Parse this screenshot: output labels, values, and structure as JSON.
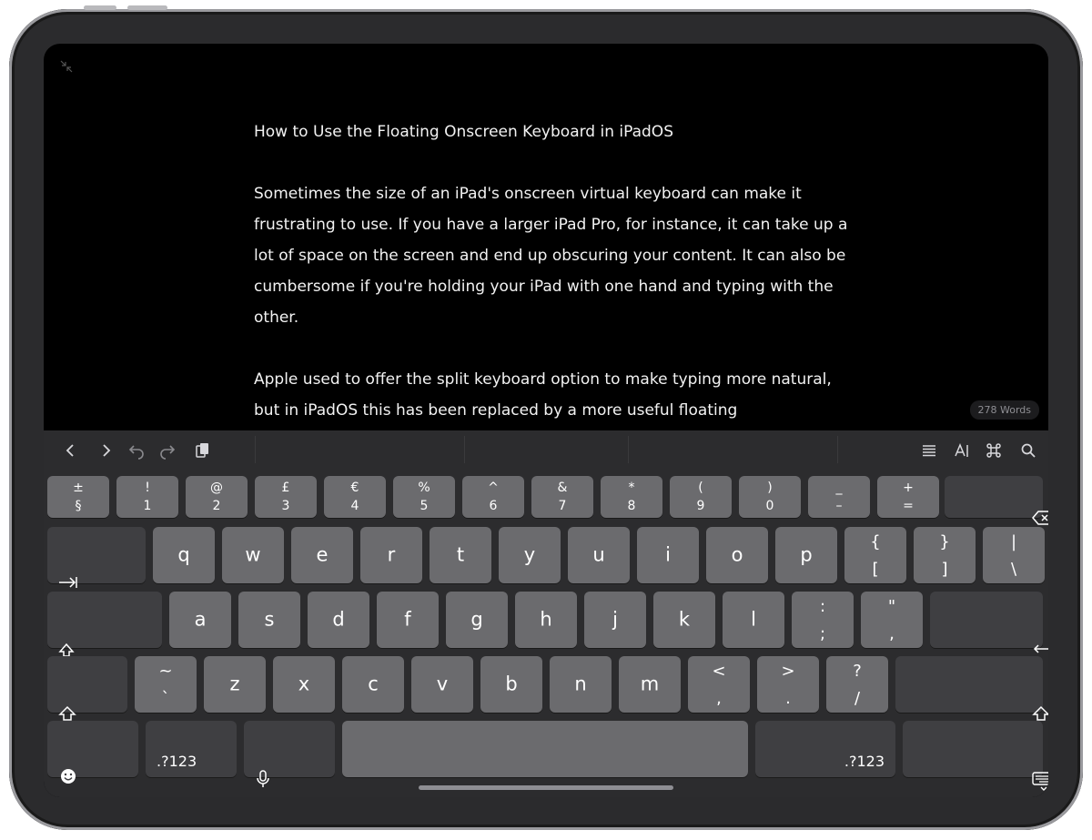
{
  "document": {
    "title": "How to Use the Floating Onscreen Keyboard in iPadOS",
    "paragraphs": [
      "Sometimes the size of an iPad's onscreen virtual keyboard can make it frustrating to use. If you have a larger iPad Pro, for instance, it can take up a lot of space on the screen and end up obscuring your content. It can also be cumbersome if you're holding your iPad with one hand and typing with the other.",
      "Apple used to offer the split keyboard option to make typing more natural, but in iPadOS this has been replaced by a more useful floating"
    ],
    "word_count": "278 Words"
  },
  "toolbar": {
    "left_icons": [
      "chevron-left-icon",
      "chevron-right-icon",
      "undo-icon",
      "redo-icon",
      "clipboard-icon"
    ],
    "right_icons": [
      "list-icon",
      "text-format-icon",
      "command-icon",
      "search-icon"
    ]
  },
  "keyboard": {
    "row1": [
      {
        "top": "±",
        "bot": "§"
      },
      {
        "top": "!",
        "bot": "1"
      },
      {
        "top": "@",
        "bot": "2"
      },
      {
        "top": "£",
        "bot": "3"
      },
      {
        "top": "€",
        "bot": "4"
      },
      {
        "top": "%",
        "bot": "5"
      },
      {
        "top": "^",
        "bot": "6"
      },
      {
        "top": "&",
        "bot": "7"
      },
      {
        "top": "*",
        "bot": "8"
      },
      {
        "top": "(",
        "bot": "9"
      },
      {
        "top": ")",
        "bot": "0"
      },
      {
        "top": "_",
        "bot": "–"
      },
      {
        "top": "+",
        "bot": "="
      }
    ],
    "row2": [
      "q",
      "w",
      "e",
      "r",
      "t",
      "y",
      "u",
      "i",
      "o",
      "p"
    ],
    "row2_sym": [
      {
        "top": "{",
        "bot": "["
      },
      {
        "top": "}",
        "bot": "]"
      },
      {
        "top": "|",
        "bot": "\\"
      }
    ],
    "row3": [
      "a",
      "s",
      "d",
      "f",
      "g",
      "h",
      "j",
      "k",
      "l"
    ],
    "row3_sym": [
      {
        "top": ":",
        "bot": ";"
      },
      {
        "top": "\"",
        "bot": ","
      }
    ],
    "row4_tilde": {
      "top": "~",
      "bot": "`"
    },
    "row4": [
      "z",
      "x",
      "c",
      "v",
      "b",
      "n",
      "m"
    ],
    "row4_sym": [
      {
        "top": "<",
        "bot": ","
      },
      {
        "top": ">",
        "bot": "."
      },
      {
        "top": "?",
        "bot": "/"
      }
    ],
    "numbers_label_left": ".?123",
    "numbers_label_right": ".?123"
  }
}
